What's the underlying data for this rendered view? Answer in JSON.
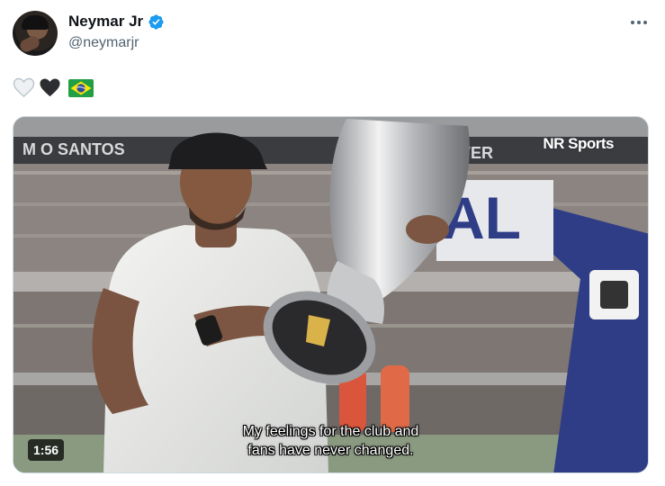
{
  "tweet": {
    "author": {
      "display_name": "Neymar Jr",
      "handle": "@neymarjr",
      "verified": true,
      "verified_color": "#1d9bf0",
      "avatar_icon": "profile-photo"
    },
    "text_emojis": [
      "white-heart",
      "black-heart",
      "brazil-flag"
    ],
    "more_icon": "more-horizontal-icon"
  },
  "media": {
    "type": "video",
    "watermark": "NR Sports",
    "caption_line1": "My feelings for the club and",
    "caption_line2": "fans have never changed.",
    "duration": "1:56"
  }
}
